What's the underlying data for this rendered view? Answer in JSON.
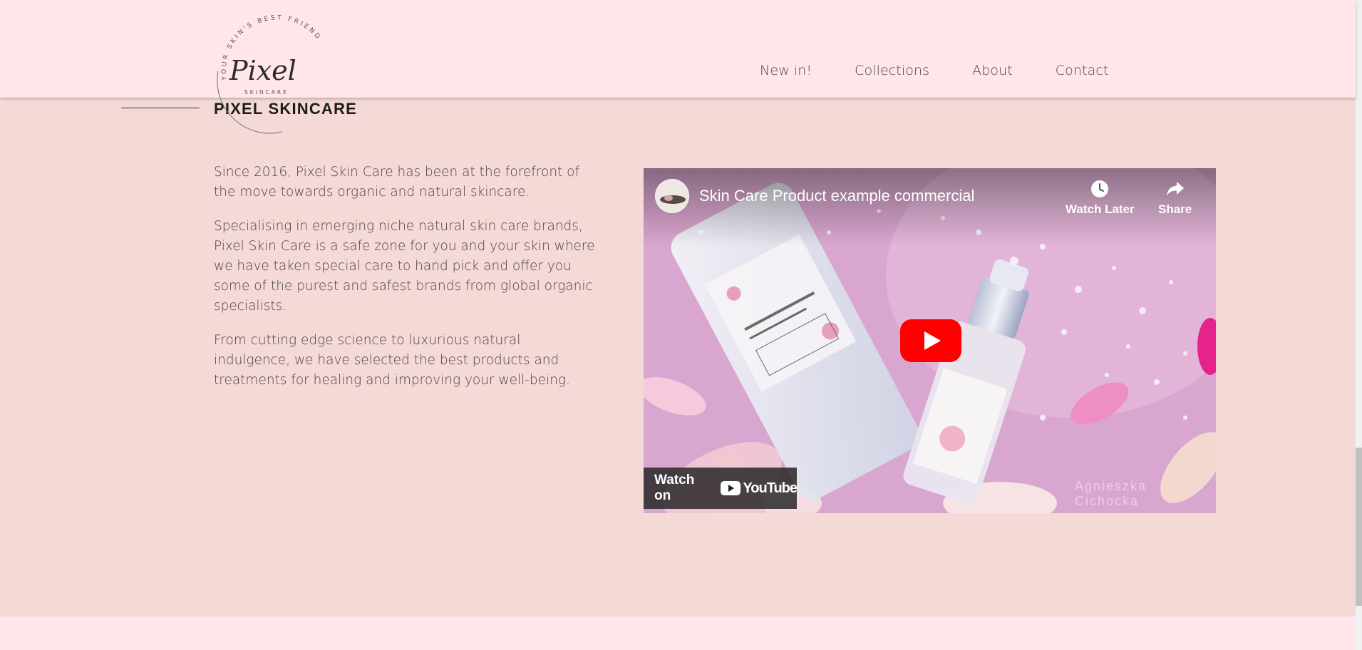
{
  "brand": {
    "logo_script": "Pixel",
    "logo_subtitle": "SKINCARE",
    "logo_ring_text": "YOUR SKIN'S BEST FRIEND"
  },
  "nav": {
    "items": [
      {
        "label": "New in!"
      },
      {
        "label": "Collections"
      },
      {
        "label": "About"
      },
      {
        "label": "Contact"
      }
    ]
  },
  "section": {
    "heading": "PIXEL SKINCARE",
    "paragraphs": [
      "Since 2016, Pixel Skin Care has been at the forefront of the move towards organic and natural skincare.",
      "Specialising in emerging niche natural skin care brands, Pixel Skin Care is a safe zone for you and your skin where we have taken special care to hand pick and offer you some of the purest and safest brands from global organic specialists.",
      "From cutting edge science to luxurious natural indulgence, we have selected the best products and treatments for healing and improving your well-being."
    ]
  },
  "video": {
    "title": "Skin Care Product example commercial",
    "watch_later_label": "Watch Later",
    "share_label": "Share",
    "watch_on_label": "Watch on",
    "youtube_wordmark": "YouTube",
    "watermark_text": "Agnieszka Cichocka"
  },
  "colors": {
    "header_bg": "#ffe6ea",
    "page_bg": "#f4d9d6",
    "youtube_red": "#ff0000"
  },
  "icons": {
    "watch_later": "clock-icon",
    "share": "share-arrow-icon",
    "play": "youtube-play-icon"
  }
}
